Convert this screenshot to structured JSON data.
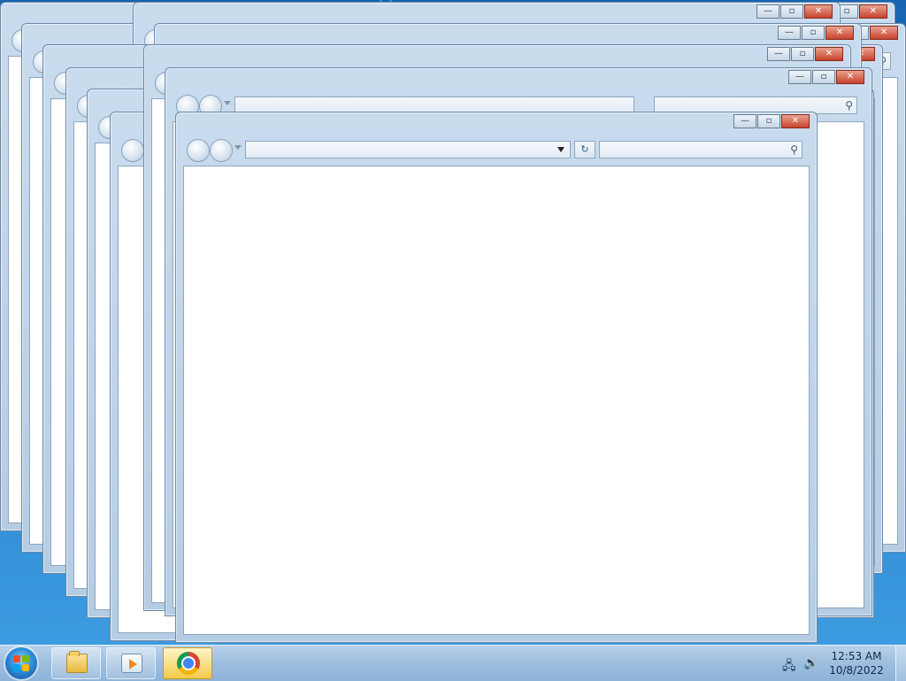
{
  "window_controls": {
    "minimize_glyph": "—",
    "maximize_glyph": "▫",
    "close_glyph": "✕"
  },
  "browser_toolbar": {
    "address_value": "",
    "refresh_glyph": "↻",
    "search_glyph": "⚲"
  },
  "icons": {
    "start": "windows-start-orb",
    "taskbar_pinned": [
      "folder-icon",
      "media-player-icon",
      "chrome-icon"
    ],
    "tray": [
      "network-icon",
      "volume-icon"
    ]
  },
  "taskbar": {
    "active_app": "chrome",
    "clock_time": "12:53 AM",
    "clock_date": "10/8/2022",
    "tray_network_glyph": "🖧",
    "tray_volume_glyph": "🔊"
  },
  "colors": {
    "close_button": "#c7432c",
    "taskbar": "#9ebfe0",
    "chrome_active_highlight": "#f4c94a"
  }
}
